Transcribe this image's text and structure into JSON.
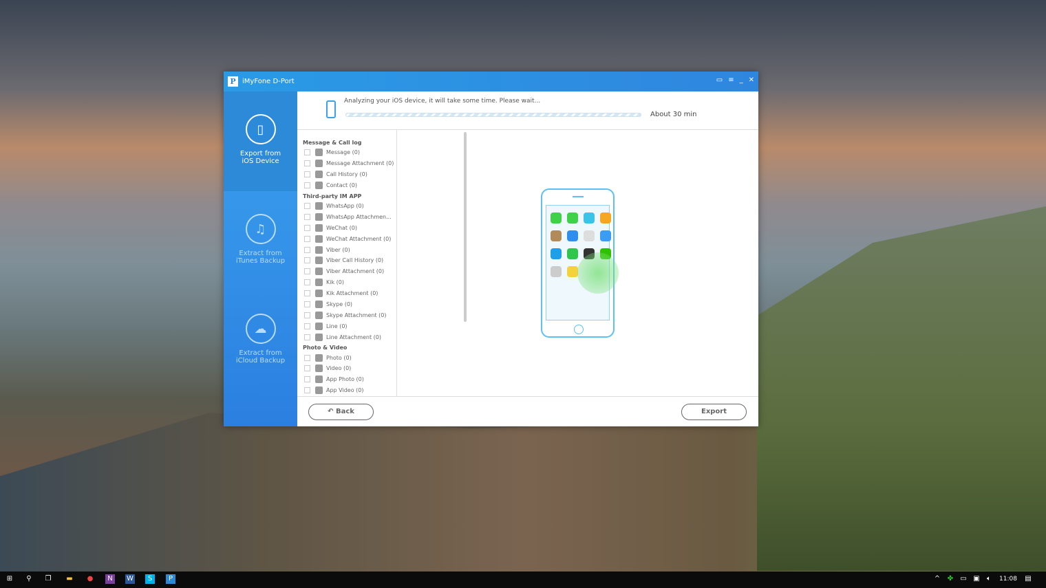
{
  "window": {
    "title": "iMyFone D-Port",
    "logo": "P"
  },
  "sidebar": [
    {
      "label1": "Export from",
      "label2": "iOS Device",
      "icon": "phone-rotate-icon"
    },
    {
      "label1": "Extract from",
      "label2": "iTunes Backup",
      "icon": "music-note-icon"
    },
    {
      "label1": "Extract from",
      "label2": "iCloud Backup",
      "icon": "cloud-download-icon"
    }
  ],
  "header": {
    "status": "Analyzing your iOS device, it will take some time. Please wait...",
    "eta": "About 30 min"
  },
  "sections": [
    {
      "title": "Message & Call log",
      "items": [
        "Message (0)",
        "Message Attachment (0)",
        "Call History (0)",
        "Contact (0)"
      ]
    },
    {
      "title": "Third-party IM APP",
      "items": [
        "WhatsApp (0)",
        "WhatsApp Attachmen...",
        "WeChat (0)",
        "WeChat Attachment (0)",
        "Viber (0)",
        "Viber Call History (0)",
        "Viber Attachment (0)",
        "Kik (0)",
        "Kik Attachment (0)",
        "Skype (0)",
        "Skype Attachment (0)",
        "Line (0)",
        "Line Attachment (0)"
      ]
    },
    {
      "title": "Photo & Video",
      "items": [
        "Photo (0)",
        "Video (0)",
        "App Photo (0)",
        "App Video (0)"
      ]
    }
  ],
  "footer": {
    "back": "Back",
    "export": "Export"
  },
  "taskbar": {
    "time": "11:08"
  },
  "colors": {
    "accent": "#2a8ad8"
  }
}
